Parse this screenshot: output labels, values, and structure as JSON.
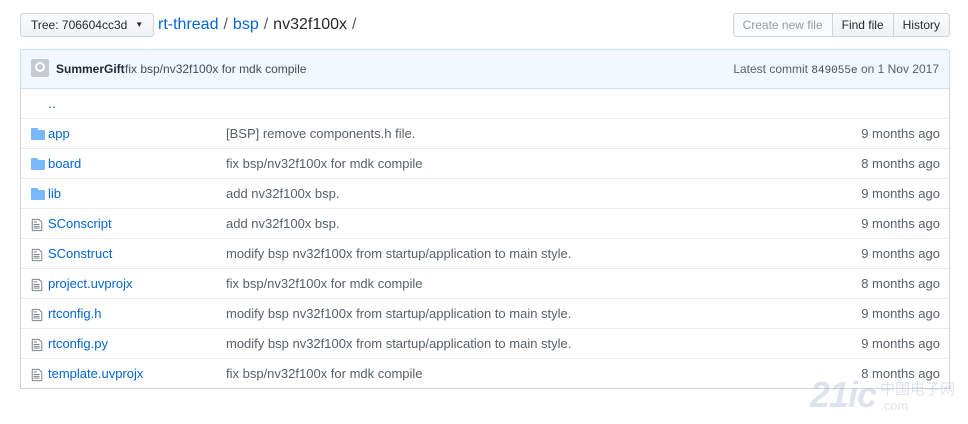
{
  "toolbar": {
    "branch_label": "Tree: 706604cc3d",
    "breadcrumb": {
      "repo": "rt-thread",
      "sep1": "/",
      "dir": "bsp",
      "sep2": "/",
      "current": "nv32f100x",
      "sep3": "/"
    },
    "create_file": "Create new file",
    "find_file": "Find file",
    "history": "History"
  },
  "commit": {
    "author": "SummerGift",
    "message": "fix bsp/nv32f100x for mdk compile",
    "latest_label": "Latest commit",
    "sha": "849055e",
    "date": "on 1 Nov 2017"
  },
  "up_dir": "..",
  "files": [
    {
      "type": "folder",
      "name": "app",
      "message": "[BSP] remove components.h file.",
      "age": "9 months ago"
    },
    {
      "type": "folder",
      "name": "board",
      "message": "fix bsp/nv32f100x for mdk compile",
      "age": "8 months ago"
    },
    {
      "type": "folder",
      "name": "lib",
      "message": "add nv32f100x bsp.",
      "age": "9 months ago"
    },
    {
      "type": "file",
      "name": "SConscript",
      "message": "add nv32f100x bsp.",
      "age": "9 months ago"
    },
    {
      "type": "file",
      "name": "SConstruct",
      "message": "modify bsp nv32f100x from startup/application to main style.",
      "age": "9 months ago"
    },
    {
      "type": "file",
      "name": "project.uvprojx",
      "message": "fix bsp/nv32f100x for mdk compile",
      "age": "8 months ago"
    },
    {
      "type": "file",
      "name": "rtconfig.h",
      "message": "modify bsp nv32f100x from startup/application to main style.",
      "age": "9 months ago"
    },
    {
      "type": "file",
      "name": "rtconfig.py",
      "message": "modify bsp nv32f100x from startup/application to main style.",
      "age": "9 months ago"
    },
    {
      "type": "file",
      "name": "template.uvprojx",
      "message": "fix bsp/nv32f100x for mdk compile",
      "age": "8 months ago"
    }
  ],
  "watermark": {
    "mark": "21ic",
    "text": "中国电子网",
    "url": ".com"
  }
}
